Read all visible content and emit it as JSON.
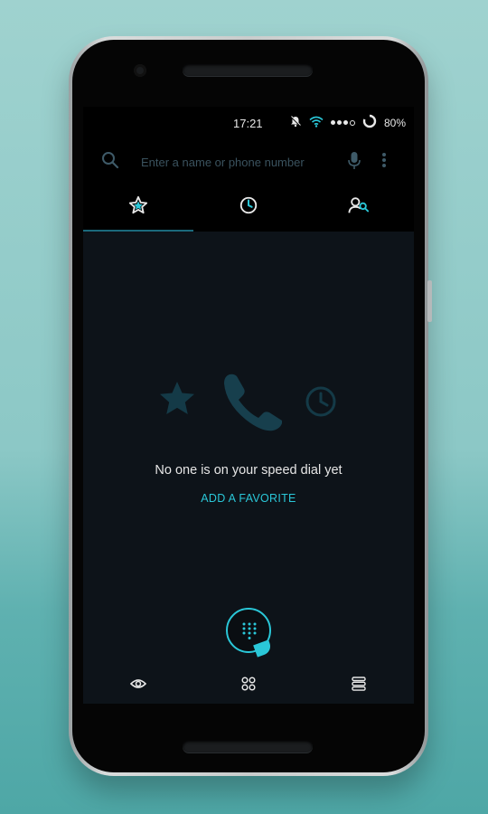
{
  "status_bar": {
    "time": "17:21",
    "battery_percent": "80%",
    "icons": [
      "alarm-icon",
      "wifi-icon",
      "signal-icon",
      "battery-icon"
    ]
  },
  "search": {
    "placeholder": "Enter a name or phone number",
    "icons": [
      "search-icon",
      "mic-icon",
      "more-vert-icon"
    ]
  },
  "tabs": [
    {
      "name": "speed-dial",
      "icon": "star-icon",
      "active": true
    },
    {
      "name": "recents",
      "icon": "clock-icon",
      "active": false
    },
    {
      "name": "contacts",
      "icon": "contacts-search-icon",
      "active": false
    }
  ],
  "empty_state": {
    "message": "No one is on your speed dial yet",
    "action_label": "ADD A FAVORITE",
    "art_icons": [
      "star-icon",
      "phone-icon",
      "clock-icon"
    ]
  },
  "fab": {
    "icon": "dialpad-icon"
  },
  "nav_bar": {
    "icons": [
      "back-icon",
      "home-icon",
      "recents-icon"
    ]
  },
  "colors": {
    "accent": "#2ac7d8",
    "background": "#0d1319",
    "faded_art": "#143a47",
    "backdrop": "#8cc8c6"
  }
}
